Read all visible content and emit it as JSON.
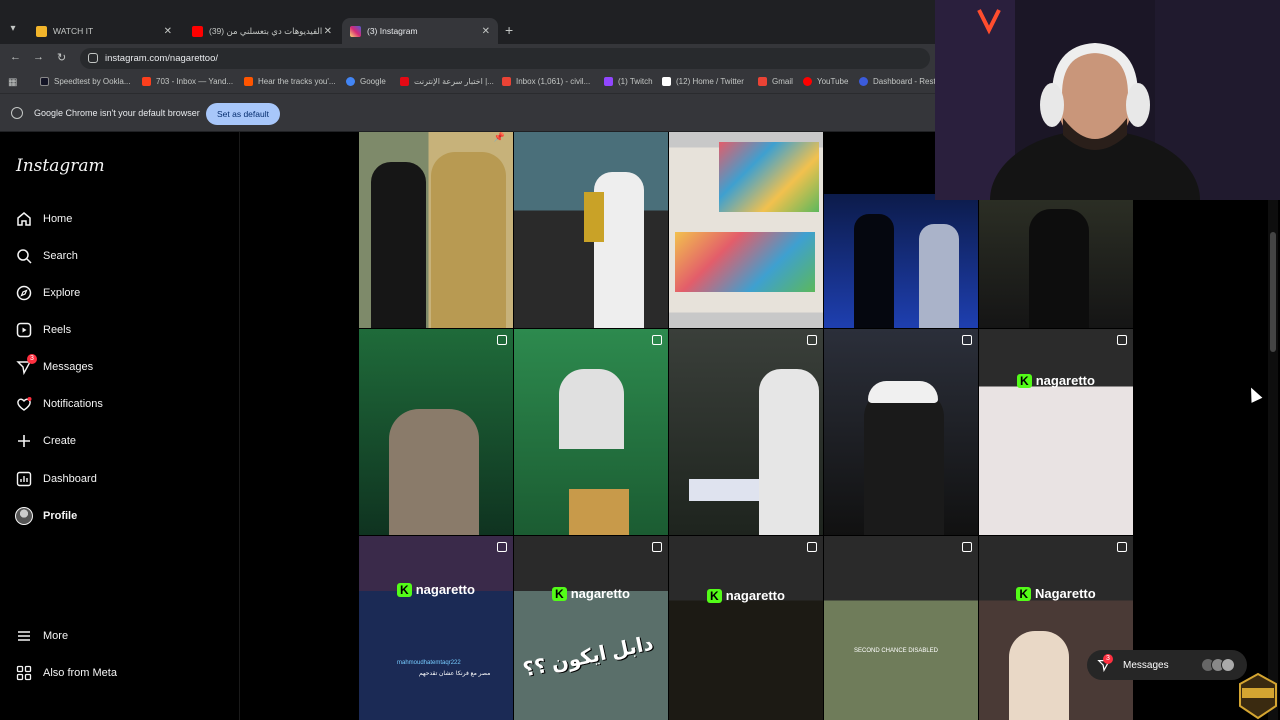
{
  "browser": {
    "tabs": [
      {
        "title": "WATCH IT",
        "fav_color": "#f2b52b",
        "active": false
      },
      {
        "title": "(39) الفيديوهات دي بتعسلني من",
        "fav_color": "#ff0000",
        "active": false
      },
      {
        "title": "(3) Instagram",
        "fav_color": "#d62976",
        "active": true
      }
    ],
    "url": "instagram.com/nagarettoo/",
    "bookmarks": [
      {
        "label": "Speedtest by Ookla...",
        "color": "#141526"
      },
      {
        "label": "703 - Inbox — Yand...",
        "color": "#fc3f1d"
      },
      {
        "label": "Hear the tracks you'...",
        "color": "#ff5500"
      },
      {
        "label": "Google",
        "color": "#4285f4"
      },
      {
        "label": "اختبار سرعة الإنترنت |...",
        "color": "#e50914"
      },
      {
        "label": "Inbox (1,061) - civil...",
        "color": "#ea4335"
      },
      {
        "label": "(1) Twitch",
        "color": "#9146ff"
      },
      {
        "label": "(12) Home / Twitter",
        "color": "#ffffff"
      },
      {
        "label": "Gmail",
        "color": "#ea4335"
      },
      {
        "label": "YouTube",
        "color": "#ff0000"
      },
      {
        "label": "Dashboard - Rest",
        "color": "#3b5bdb"
      }
    ],
    "infobar": {
      "message": "Google Chrome isn't your default browser",
      "button": "Set as default"
    }
  },
  "instagram": {
    "logo": "Instagram",
    "nav": [
      {
        "label": "Home",
        "icon": "home-icon"
      },
      {
        "label": "Search",
        "icon": "search-icon"
      },
      {
        "label": "Explore",
        "icon": "compass-icon"
      },
      {
        "label": "Reels",
        "icon": "reels-icon"
      },
      {
        "label": "Messages",
        "icon": "messenger-icon",
        "badge": "3"
      },
      {
        "label": "Notifications",
        "icon": "heart-icon"
      },
      {
        "label": "Create",
        "icon": "plus-icon"
      },
      {
        "label": "Dashboard",
        "icon": "chart-icon"
      },
      {
        "label": "Profile",
        "icon": "avatar-icon"
      }
    ],
    "more": [
      {
        "label": "More",
        "icon": "menu-icon"
      },
      {
        "label": "Also from Meta",
        "icon": "meta-icon"
      }
    ],
    "grid_captions": {
      "kick_name": "nagaretto",
      "kick_name_caps": "Nagaretto",
      "arabic_caption": "دابل ايكون ؟؟",
      "comment_user": "mahmoudhatemtaqr222",
      "comment_text": "مصر مع فرنكا عشان تقدحهم",
      "game_text": "SECOND CHANCE DISABLED"
    },
    "messages_bar": {
      "label": "Messages",
      "badge": "3"
    }
  },
  "colors": {
    "chrome_bg": "#35363a",
    "tabstrip_bg": "#1f2023",
    "accent_button": "#a8c7fa",
    "kick_green": "#53fc18",
    "ig_badge": "#ff3040"
  }
}
